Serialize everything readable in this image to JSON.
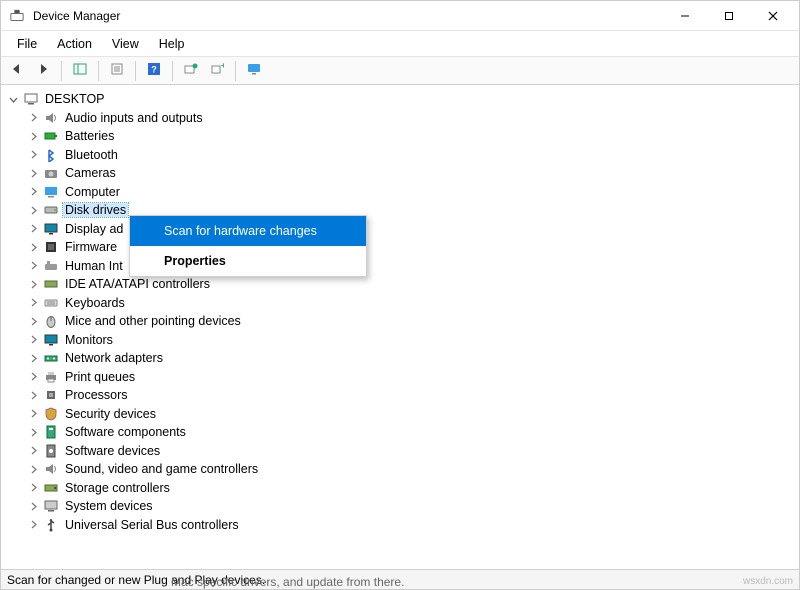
{
  "window": {
    "title": "Device Manager"
  },
  "menubar": {
    "file": "File",
    "action": "Action",
    "view": "View",
    "help": "Help"
  },
  "tree": {
    "root": "DESKTOP",
    "items": [
      {
        "label": "Audio inputs and outputs",
        "iconName": "speaker-icon"
      },
      {
        "label": "Batteries",
        "iconName": "battery-icon"
      },
      {
        "label": "Bluetooth",
        "iconName": "bluetooth-icon"
      },
      {
        "label": "Cameras",
        "iconName": "camera-icon"
      },
      {
        "label": "Computer",
        "iconName": "computer-icon"
      },
      {
        "label": "Disk drives",
        "iconName": "disk-icon",
        "selected": true
      },
      {
        "label": "Display adapters",
        "iconName": "display-icon",
        "truncated": "Display ad"
      },
      {
        "label": "Firmware",
        "iconName": "firmware-icon"
      },
      {
        "label": "Human Interface Devices",
        "iconName": "hid-icon",
        "truncated": "Human Int"
      },
      {
        "label": "IDE ATA/ATAPI controllers",
        "iconName": "ide-icon"
      },
      {
        "label": "Keyboards",
        "iconName": "keyboard-icon"
      },
      {
        "label": "Mice and other pointing devices",
        "iconName": "mouse-icon"
      },
      {
        "label": "Monitors",
        "iconName": "monitor-icon"
      },
      {
        "label": "Network adapters",
        "iconName": "network-icon"
      },
      {
        "label": "Print queues",
        "iconName": "printer-icon"
      },
      {
        "label": "Processors",
        "iconName": "cpu-icon"
      },
      {
        "label": "Security devices",
        "iconName": "security-icon"
      },
      {
        "label": "Software components",
        "iconName": "swcomponent-icon"
      },
      {
        "label": "Software devices",
        "iconName": "swdevice-icon"
      },
      {
        "label": "Sound, video and game controllers",
        "iconName": "sound-icon"
      },
      {
        "label": "Storage controllers",
        "iconName": "storage-icon"
      },
      {
        "label": "System devices",
        "iconName": "system-icon"
      },
      {
        "label": "Universal Serial Bus controllers",
        "iconName": "usb-icon"
      }
    ]
  },
  "context_menu": {
    "scan": "Scan for hardware changes",
    "properties": "Properties"
  },
  "statusbar": {
    "text": "Scan for changed or new Plug and Play devices."
  },
  "watermark": "wsxdn.com",
  "caption_below": "Mac specific drivers, and update from there."
}
